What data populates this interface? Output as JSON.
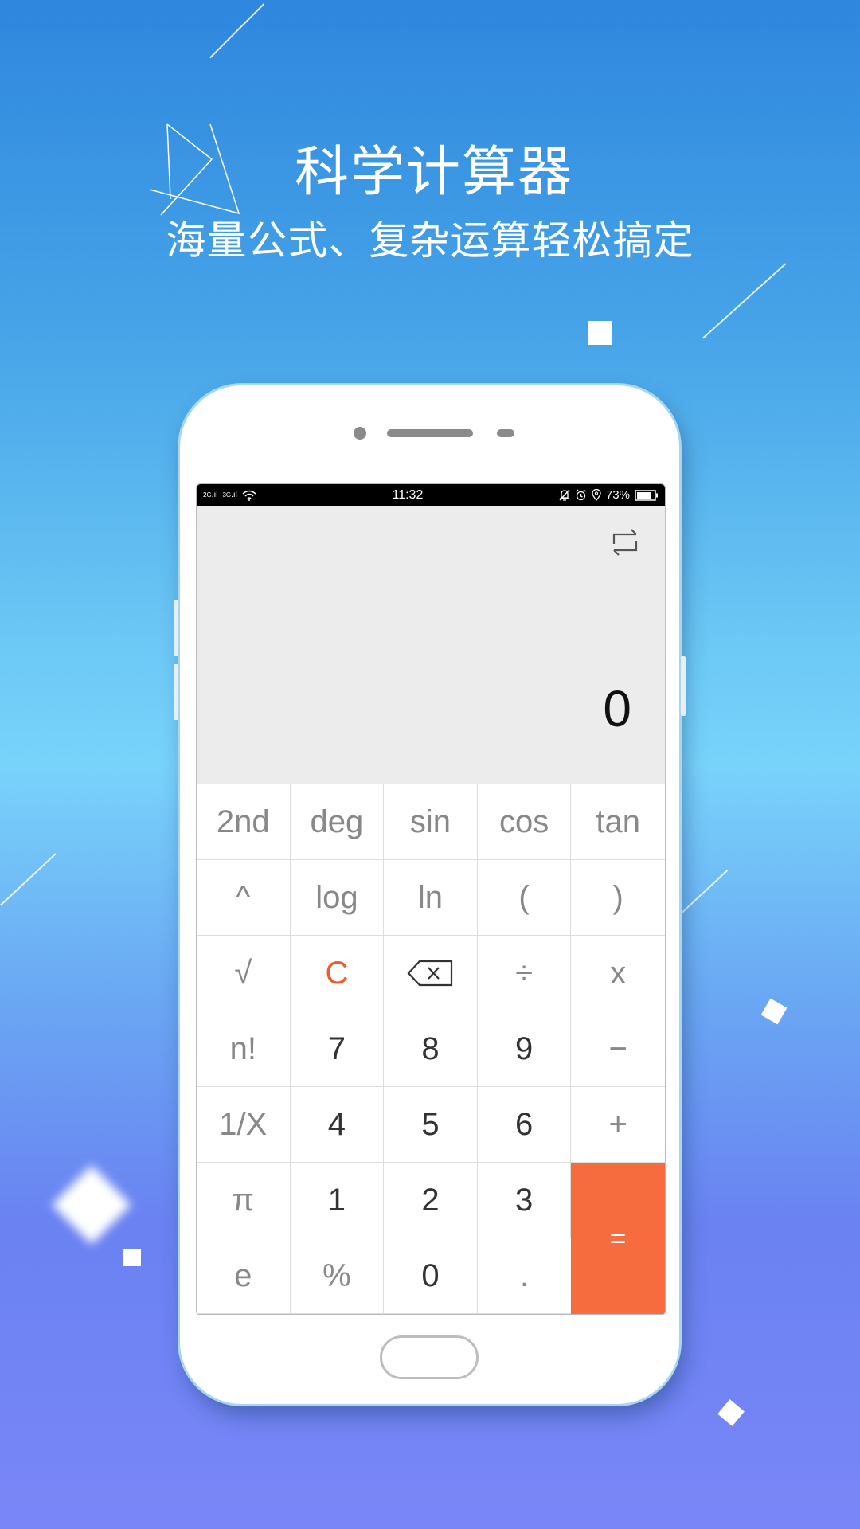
{
  "promo": {
    "title": "科学计算器",
    "subtitle": "海量公式、复杂运算轻松搞定"
  },
  "status_bar": {
    "signal_1": "2G",
    "signal_2": "3G",
    "time": "11:32",
    "battery": "73%",
    "icons": [
      "signal-2g-icon",
      "signal-3g-icon",
      "wifi-icon",
      "bell-muted-icon",
      "alarm-icon",
      "location-icon",
      "battery-icon"
    ]
  },
  "display": {
    "result": "0",
    "mode_toggle_icon": "swap-icon"
  },
  "keypad": {
    "rows": [
      [
        "2nd",
        "deg",
        "sin",
        "cos",
        "tan"
      ],
      [
        "^",
        "log",
        "ln",
        "(",
        ")"
      ],
      [
        "√",
        "C",
        "⌫",
        "÷",
        "x"
      ],
      [
        "n!",
        "7",
        "8",
        "9",
        "−"
      ],
      [
        "1/X",
        "4",
        "5",
        "6",
        "+"
      ],
      [
        "π",
        "1",
        "2",
        "3",
        "="
      ],
      [
        "e",
        "%",
        "0",
        "."
      ]
    ]
  },
  "colors": {
    "accent": "#f76c3f",
    "clear": "#f25a2a",
    "display_bg": "#ececec"
  }
}
